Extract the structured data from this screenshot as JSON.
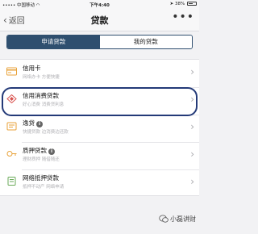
{
  "status_bar": {
    "carrier": "中国移动",
    "time": "下午4:40",
    "battery": "38%"
  },
  "nav": {
    "back_label": "返回",
    "title": "贷款",
    "more": "•••"
  },
  "tabs": [
    {
      "label": "申请贷款",
      "active": true
    },
    {
      "label": "我的贷款",
      "active": false
    }
  ],
  "loan_items": [
    {
      "title": "信用卡",
      "subtitle": "网络办卡 方便快捷",
      "icon": "credit-card-icon",
      "has_info": false
    },
    {
      "title": "信用消费贷款",
      "subtitle": "好心消费 消费贷利息",
      "icon": "consumer-loan-icon",
      "has_info": false
    },
    {
      "title": "逸贷",
      "subtitle": "快捷贷款 边消费边还款",
      "icon": "yidai-icon",
      "has_info": true
    },
    {
      "title": "质押贷款",
      "subtitle": "理财质押 随借随还",
      "icon": "pledge-icon",
      "has_info": true
    },
    {
      "title": "网络抵押贷款",
      "subtitle": "抵押不动产 网络申请",
      "icon": "mortgage-icon",
      "has_info": false
    }
  ],
  "watermark": "小磊讲财",
  "colors": {
    "segment_active": "#2f4f6f",
    "highlight": "#243a78",
    "icon_orange": "#e8a23a",
    "icon_red": "#d9534f"
  }
}
